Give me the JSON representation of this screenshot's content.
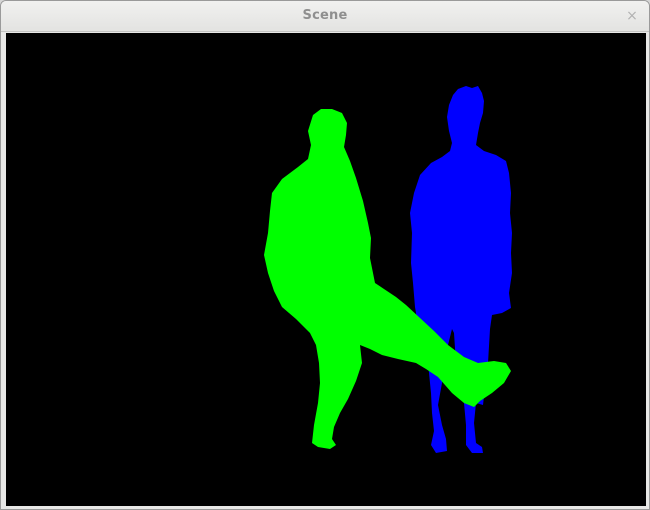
{
  "window": {
    "title": "Scene",
    "close_glyph": "×",
    "close_icon": "close-icon"
  },
  "scene": {
    "background_color": "#000000",
    "silhouettes": [
      {
        "name": "green-person-silhouette",
        "color": "#00ff00"
      },
      {
        "name": "blue-person-silhouette",
        "color": "#0000ff"
      }
    ]
  }
}
